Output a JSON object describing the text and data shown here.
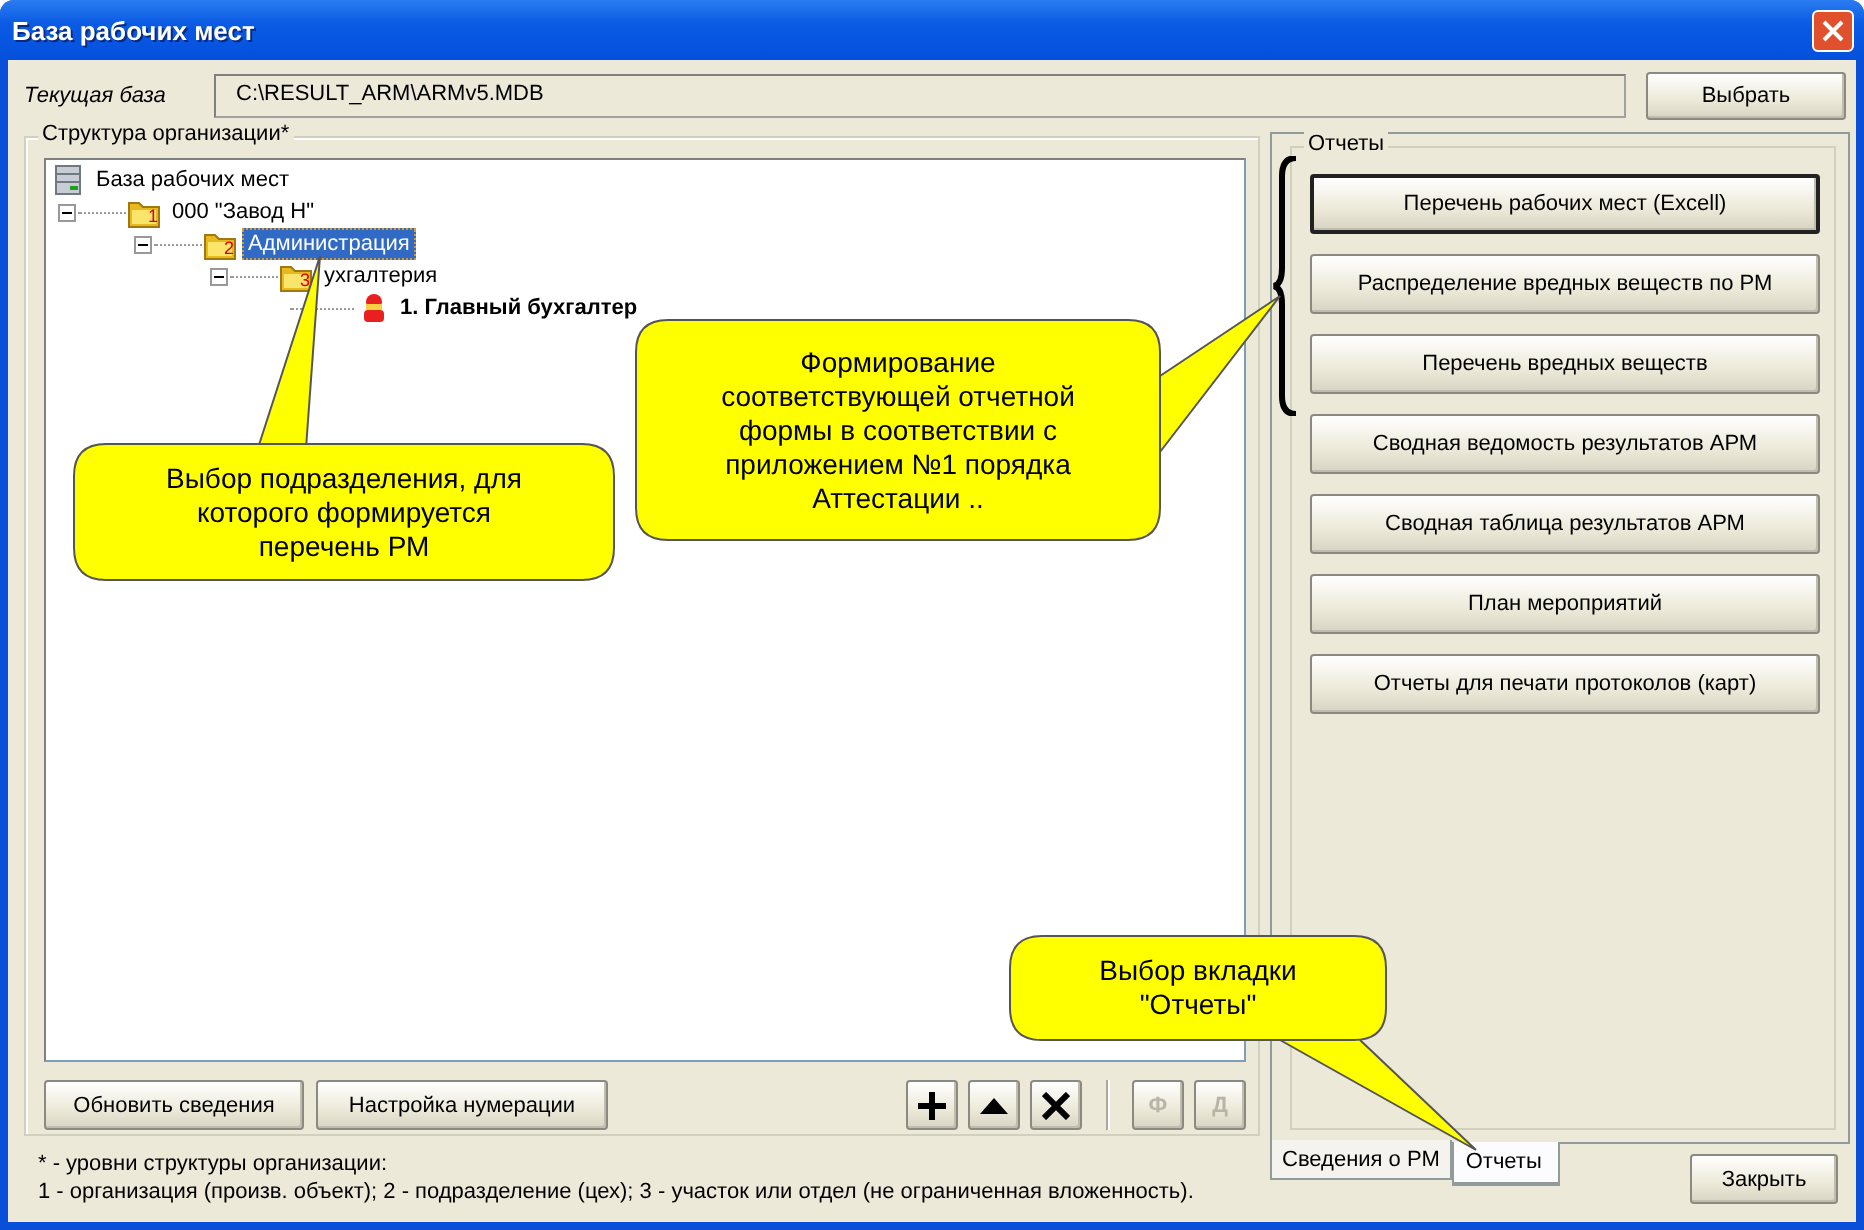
{
  "window": {
    "title": "База рабочих мест"
  },
  "current_db": {
    "label": "Текущая база",
    "value": "C:\\RESULT_ARM\\ARMv5.MDB",
    "button": "Выбрать"
  },
  "structure": {
    "title": "Структура организации*",
    "tree": [
      {
        "kind": "database",
        "label": "База рабочих мест",
        "selected": false,
        "children": [
          {
            "kind": "folder",
            "badge": "1",
            "label": "000 \"Завод Н\"",
            "expanded": true,
            "selected": false,
            "children": [
              {
                "kind": "folder",
                "badge": "2",
                "label": "Администрация",
                "expanded": true,
                "selected": true,
                "children": [
                  {
                    "kind": "folder",
                    "badge": "3",
                    "label": "ухгалтерия",
                    "expanded": true,
                    "selected": false,
                    "children": [
                      {
                        "kind": "position",
                        "label": "1. Главный бухгалтер",
                        "selected": false
                      }
                    ]
                  }
                ]
              }
            ]
          }
        ]
      }
    ],
    "buttons": [
      "Обновить сведения",
      "Настройка нумерации"
    ],
    "tools": [
      {
        "kind": "add",
        "disabled": false
      },
      {
        "kind": "up",
        "disabled": false
      },
      {
        "kind": "delete",
        "disabled": false
      },
      {
        "kind": "letter",
        "label": "Ф",
        "disabled": true
      },
      {
        "kind": "letter",
        "label": "Д",
        "disabled": true
      }
    ]
  },
  "footnote": [
    "* - уровни структуры организации:",
    "1 - организация (произв. объект); 2 - подразделение (цех); 3 - участок или отдел (не ограниченная вложенность)."
  ],
  "reports": {
    "title": "Отчеты",
    "buttons": [
      {
        "label": "Перечень рабочих мест (Excell)",
        "focused": true
      },
      {
        "label": "Распределение вредных веществ по РМ",
        "focused": false
      },
      {
        "label": "Перечень вредных веществ",
        "focused": false
      },
      {
        "label": "Сводная ведомость результатов АРМ",
        "focused": false
      },
      {
        "label": "Сводная таблица результатов АРМ",
        "focused": false
      },
      {
        "label": "План мероприятий",
        "focused": false
      },
      {
        "label": "Отчеты для печати протоколов (карт)",
        "focused": false
      }
    ]
  },
  "tabs": [
    {
      "label": "Сведения о РМ",
      "selected": false
    },
    {
      "label": "Отчеты",
      "selected": true
    }
  ],
  "close_button": "Закрыть",
  "callouts": [
    {
      "text": "Выбор подразделения, для которого формируется перечень РМ"
    },
    {
      "text": "Формирование соответствующей отчетной формы в соответствии с приложением №1 порядка Аттестации .."
    },
    {
      "text": "Выбор вкладки \"Отчеты\""
    }
  ]
}
